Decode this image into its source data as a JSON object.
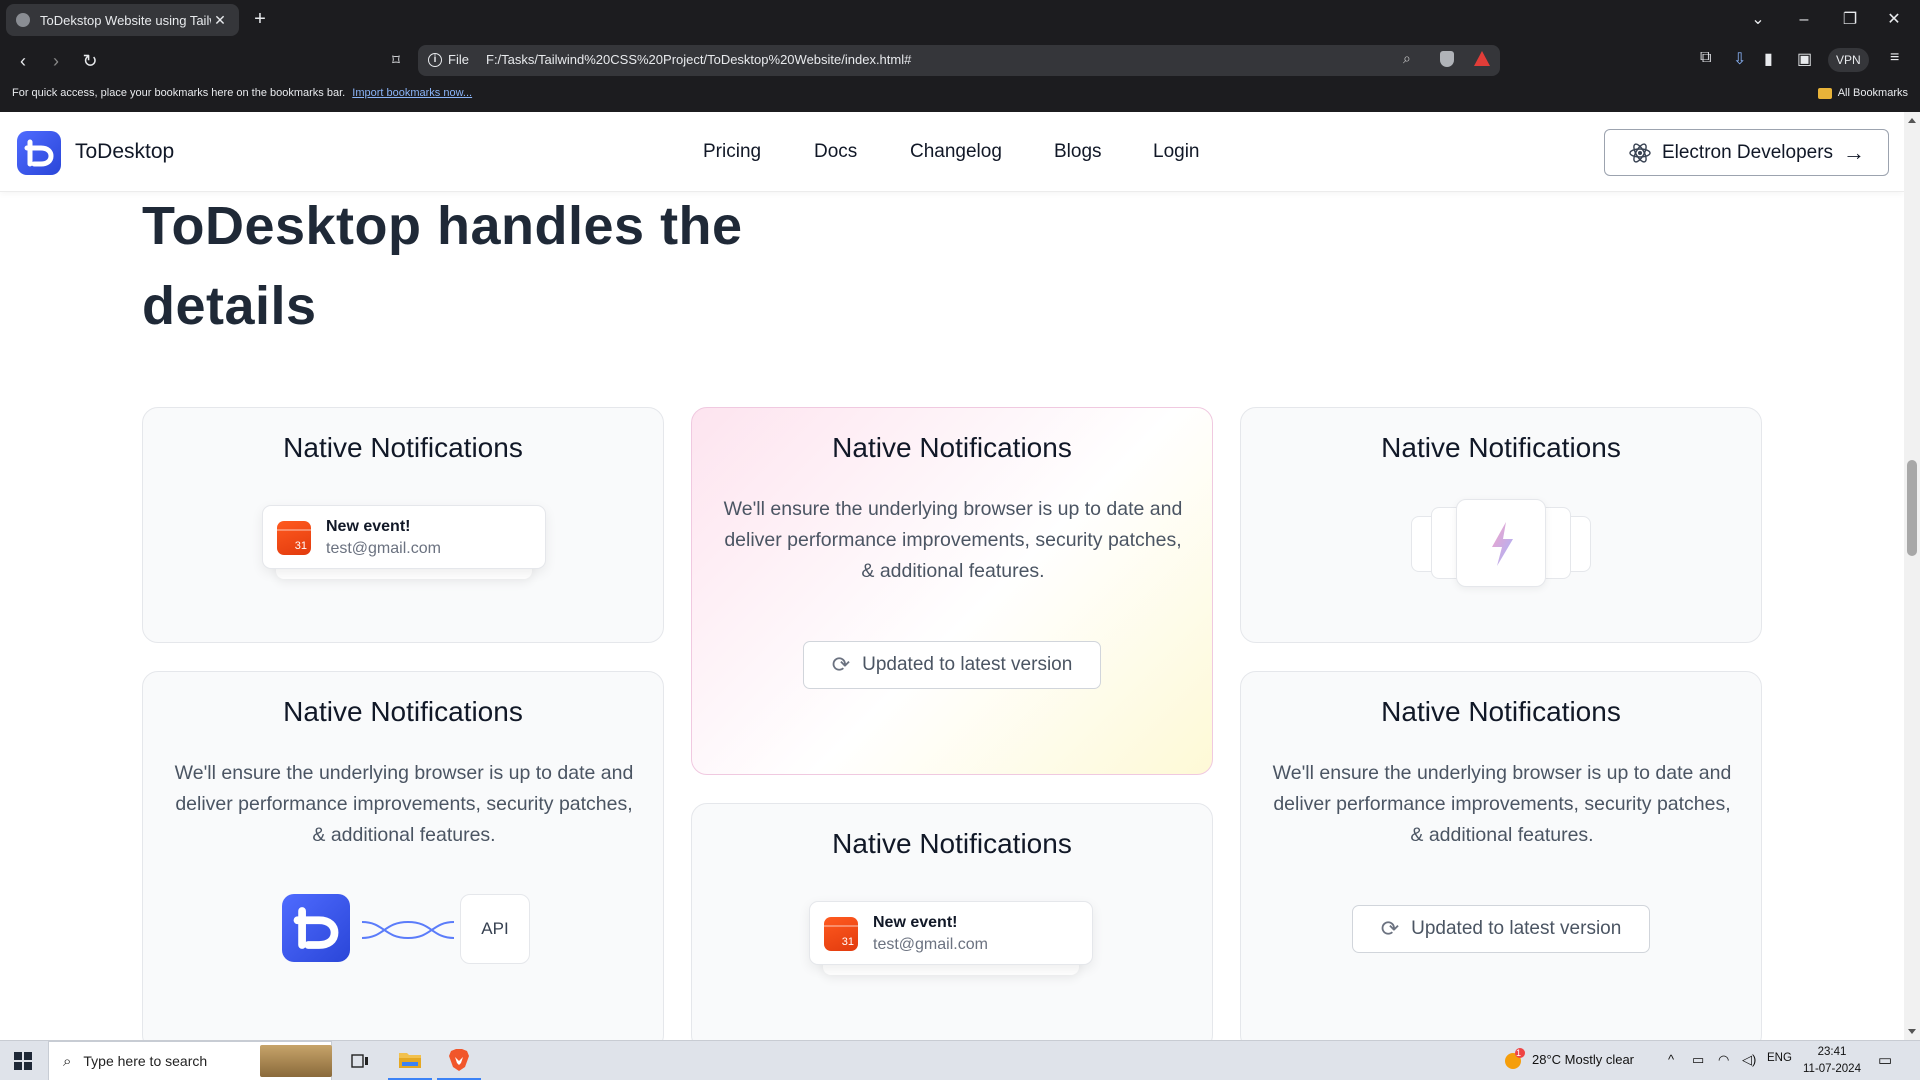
{
  "browser": {
    "tab_title": "ToDekstop Website using Tailwi",
    "address_scheme": "File",
    "address_url": "F:/Tasks/Tailwind%20CSS%20Project/ToDesktop%20Website/index.html#",
    "vpn_label": "VPN",
    "bookmarks_message": "For quick access, place your bookmarks here on the bookmarks bar.",
    "bookmarks_link": "Import bookmarks now...",
    "all_bookmarks": "All Bookmarks"
  },
  "site": {
    "brand": "ToDesktop",
    "nav": [
      "Pricing",
      "Docs",
      "Changelog",
      "Blogs",
      "Login"
    ],
    "cta": "Electron Developers",
    "headline_line1": "ToDesktop handles the",
    "headline_line2": "details"
  },
  "cards": {
    "c1": {
      "title": "Native Notifications",
      "notif_title": "New event!",
      "notif_email": "test@gmail.com",
      "cal_day": "31"
    },
    "c2": {
      "title": "Native Notifications",
      "body": "We'll ensure the underlying browser is up to date and deliver performance improvements, security patches, & additional features.",
      "button": "Updated to latest version"
    },
    "c3": {
      "title": "Native Notifications"
    },
    "c4": {
      "title": "Native Notifications",
      "body": "We'll ensure the underlying browser is up to date and deliver performance improvements, security patches, & additional features.",
      "api_label": "API"
    },
    "c5": {
      "title": "Native Notifications",
      "notif_title": "New event!",
      "notif_email": "test@gmail.com",
      "cal_day": "31"
    },
    "c6": {
      "title": "Native Notifications",
      "body": "We'll ensure the underlying browser is up to date and deliver performance improvements, security patches, & additional features.",
      "button": "Updated to latest version"
    }
  },
  "taskbar": {
    "search_placeholder": "Type here to search",
    "weather": "28°C  Mostly clear",
    "weather_badge": "1",
    "lang": "ENG",
    "time": "23:41",
    "date": "11-07-2024"
  },
  "colors": {
    "brand_blue": "#3b5bfd",
    "calendar_orange": "#ff5a1f",
    "text_dark": "#111827"
  }
}
